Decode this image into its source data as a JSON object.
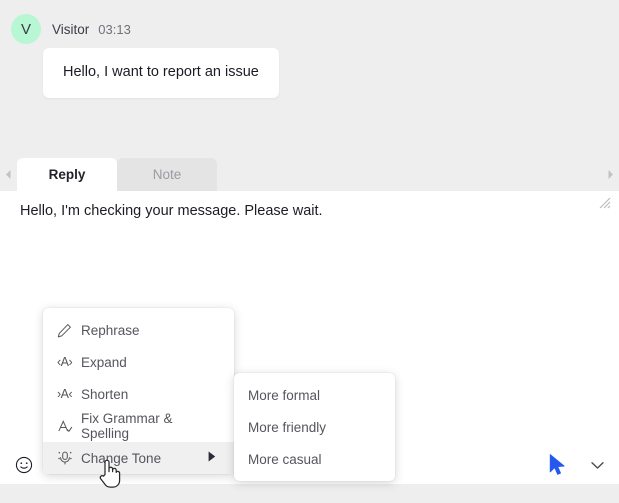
{
  "conversation": {
    "message": {
      "avatar_initial": "V",
      "sender": "Visitor",
      "time": "03:13",
      "text": "Hello, I want to report an issue",
      "avatar_color": "#b7f7d4",
      "bubble_color": "#ffffff"
    },
    "scroll_left_icon": "chevron-left-icon",
    "scroll_right_icon": "chevron-right-icon"
  },
  "composer": {
    "tabs": [
      {
        "label": "Reply",
        "active": true
      },
      {
        "label": "Note",
        "active": false
      }
    ],
    "editor_text": "Hello, I'm checking your message. Please wait.",
    "resize_handle_icon": "resize-grip-icon",
    "toolbar": {
      "items": [
        {
          "icon": "emoji-smiley-icon",
          "name": "emoji-button"
        },
        {
          "icon": "ai-magic-pencil-icon",
          "name": "ai-assist-button"
        },
        {
          "icon": "canned-response-icon",
          "name": "canned-response-button"
        },
        {
          "icon": "link-icon",
          "name": "insert-link-button"
        }
      ],
      "send_icon": "send-cursor-icon",
      "send_color": "#2558ee",
      "dropdown_icon": "chevron-down-icon"
    }
  },
  "ai_menu": {
    "items": [
      {
        "label": "Rephrase",
        "icon": "pencil-icon",
        "highlighted": false,
        "has_submenu": false
      },
      {
        "label": "Expand",
        "icon": "expand-text-icon",
        "highlighted": false,
        "has_submenu": false
      },
      {
        "label": "Shorten",
        "icon": "shorten-text-icon",
        "highlighted": false,
        "has_submenu": false
      },
      {
        "label": "Fix Grammar & Spelling",
        "icon": "grammar-check-icon",
        "highlighted": false,
        "has_submenu": false
      },
      {
        "label": "Change Tone",
        "icon": "change-tone-icon",
        "highlighted": true,
        "has_submenu": true
      }
    ],
    "submenu_arrow_icon": "caret-right-icon",
    "highlight_color": "#f0f0f0"
  },
  "tone_submenu": {
    "items": [
      {
        "label": "More formal"
      },
      {
        "label": "More friendly"
      },
      {
        "label": "More casual"
      }
    ]
  },
  "cursor": {
    "type": "pointing-hand-cursor"
  },
  "colors": {
    "page_background": "#eeeeee",
    "panel_background": "#ffffff",
    "text_primary": "#1c1c24",
    "text_muted": "#6f7278",
    "accent_blue": "#2558ee"
  }
}
